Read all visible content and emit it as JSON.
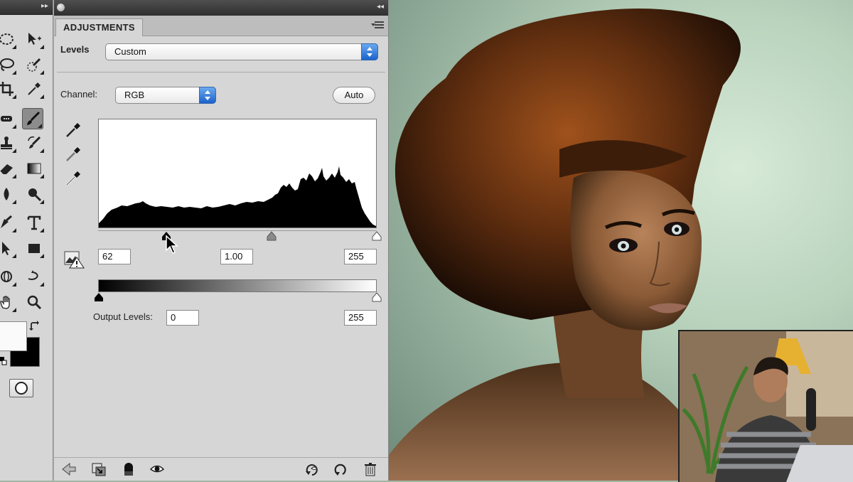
{
  "panel": {
    "tab_label": "ADJUSTMENTS",
    "preset_label": "Levels",
    "preset_value": "Custom",
    "channel_label": "Channel:",
    "channel_value": "RGB",
    "auto_label": "Auto",
    "input_levels": {
      "black": "62",
      "gamma": "1.00",
      "white": "255"
    },
    "output_levels_label": "Output Levels:",
    "output_levels": {
      "black": "0",
      "white": "255"
    }
  },
  "icons": {
    "tools": [
      "marquee-icon",
      "move-icon",
      "lasso-icon",
      "quick-selection-icon",
      "crop-icon",
      "eyedropper-icon",
      "healing-brush-icon",
      "brush-icon",
      "clone-stamp-icon",
      "history-brush-icon",
      "eraser-icon",
      "gradient-icon",
      "blur-icon",
      "dodge-icon",
      "pen-icon",
      "type-icon",
      "path-selection-icon",
      "shape-icon",
      "3d-rotate-icon",
      "3d-orbit-icon",
      "hand-icon",
      "zoom-icon"
    ],
    "footer": [
      "back-arrow-icon",
      "clip-to-layer-icon",
      "layer-mask-icon",
      "visibility-eye-icon",
      "view-previous-icon",
      "reset-icon",
      "trash-icon"
    ]
  },
  "colors": {
    "accent": "#1b62cc",
    "panel_bg": "#d6d6d6",
    "header_bg": "#3a3a3a"
  }
}
